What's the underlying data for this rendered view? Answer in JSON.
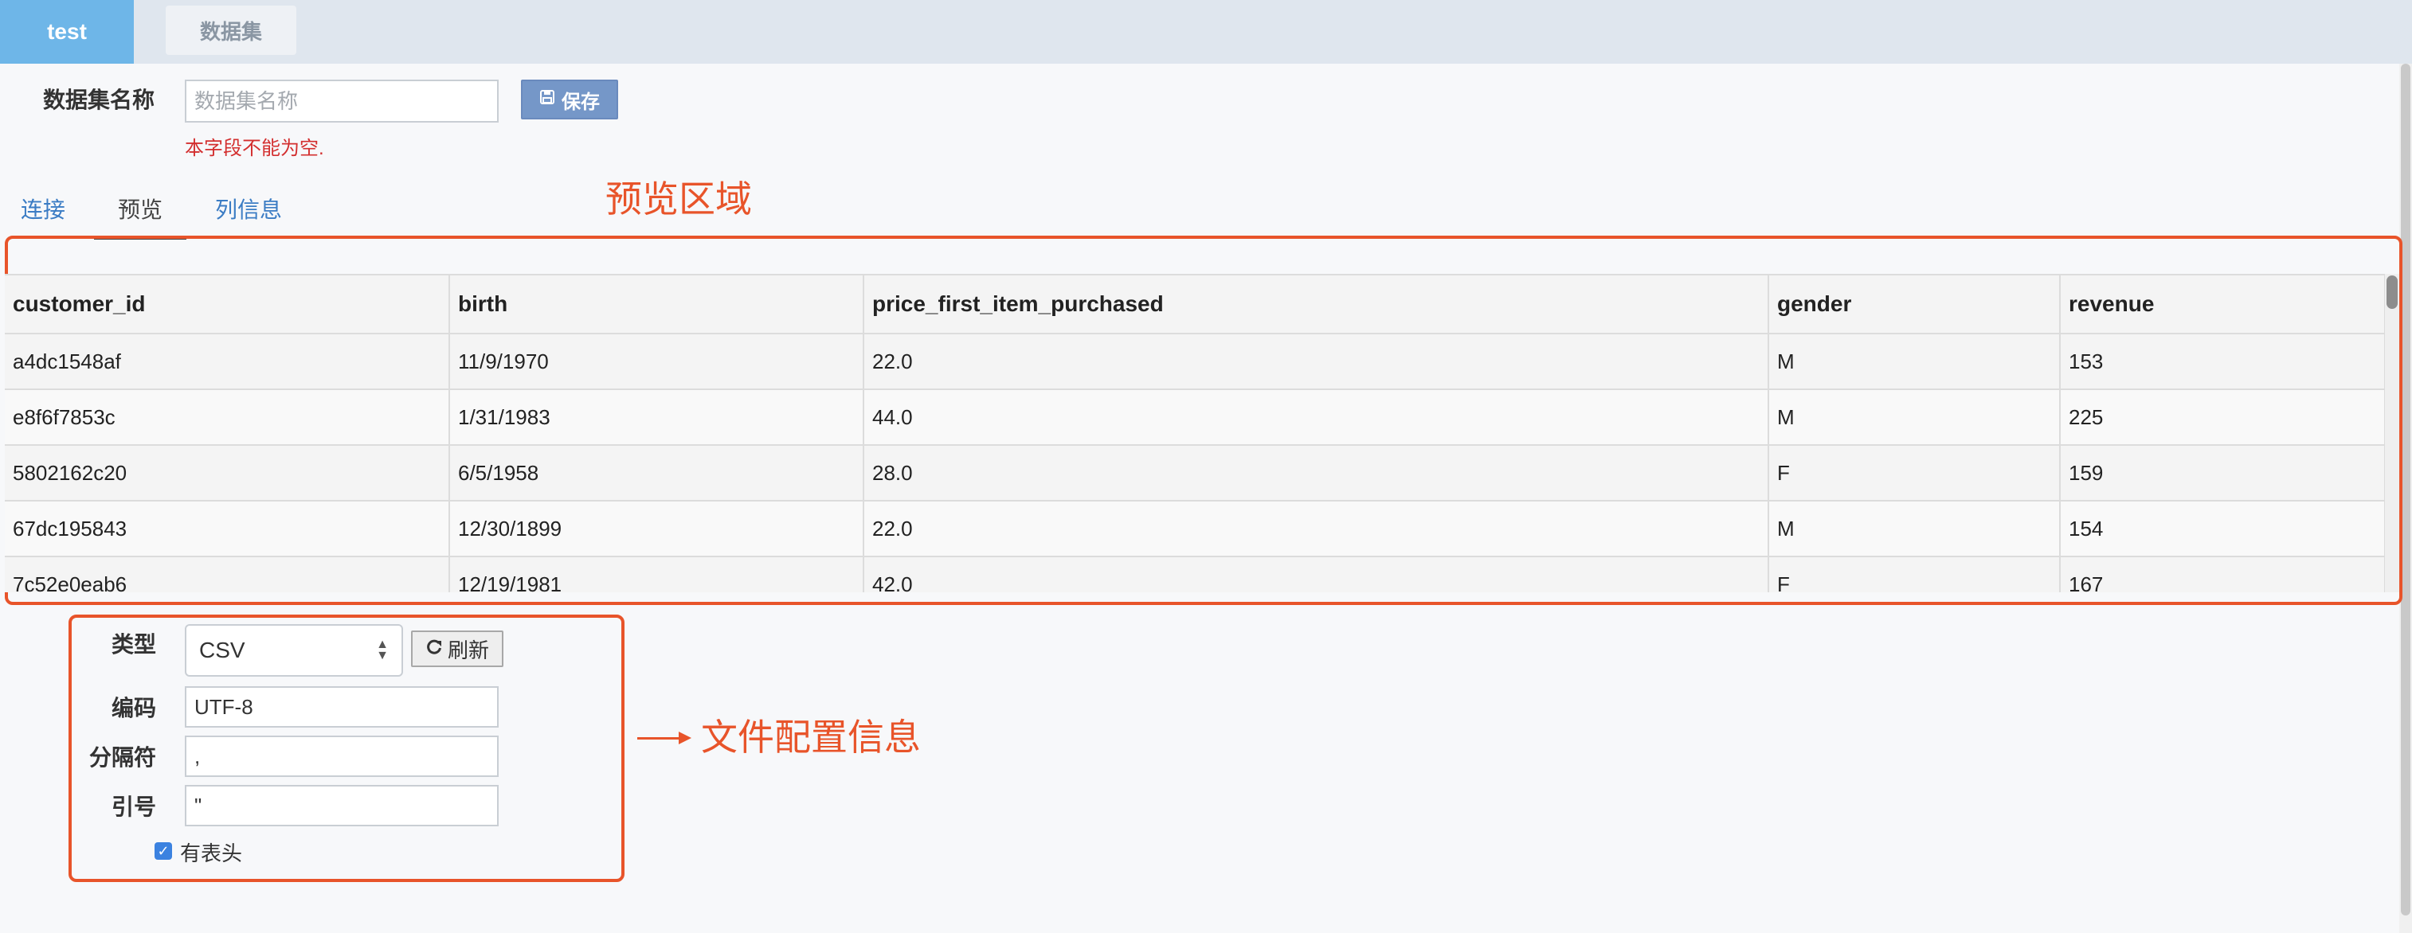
{
  "tabs": {
    "active": "test",
    "other": "数据集"
  },
  "form": {
    "name_label": "数据集名称",
    "name_placeholder": "数据集名称",
    "save_label": "保存",
    "error_text": "本字段不能为空."
  },
  "subtabs": [
    "连接",
    "预览",
    "列信息"
  ],
  "annotations": {
    "preview_area": "预览区域",
    "file_config": "文件配置信息"
  },
  "preview_table": {
    "columns": [
      "customer_id",
      "birth",
      "price_first_item_purchased",
      "gender",
      "revenue"
    ],
    "rows": [
      [
        "a4dc1548af",
        "11/9/1970",
        "22.0",
        "M",
        "153"
      ],
      [
        "e8f6f7853c",
        "1/31/1983",
        "44.0",
        "M",
        "225"
      ],
      [
        "5802162c20",
        "6/5/1958",
        "28.0",
        "F",
        "159"
      ],
      [
        "67dc195843",
        "12/30/1899",
        "22.0",
        "M",
        "154"
      ],
      [
        "7c52e0eab6",
        "12/19/1981",
        "42.0",
        "F",
        "167"
      ]
    ]
  },
  "config": {
    "type_label": "类型",
    "type_value": "CSV",
    "refresh_label": "刷新",
    "encoding_label": "编码",
    "encoding_value": "UTF-8",
    "delimiter_label": "分隔符",
    "delimiter_value": ",",
    "quote_label": "引号",
    "quote_value": "\"",
    "header_label": "有表头",
    "has_header": true
  },
  "colors": {
    "accent_tab": "#6eb6e8",
    "annotation": "#e8542a",
    "save_button": "#7597c8",
    "error": "#d32f2f"
  }
}
